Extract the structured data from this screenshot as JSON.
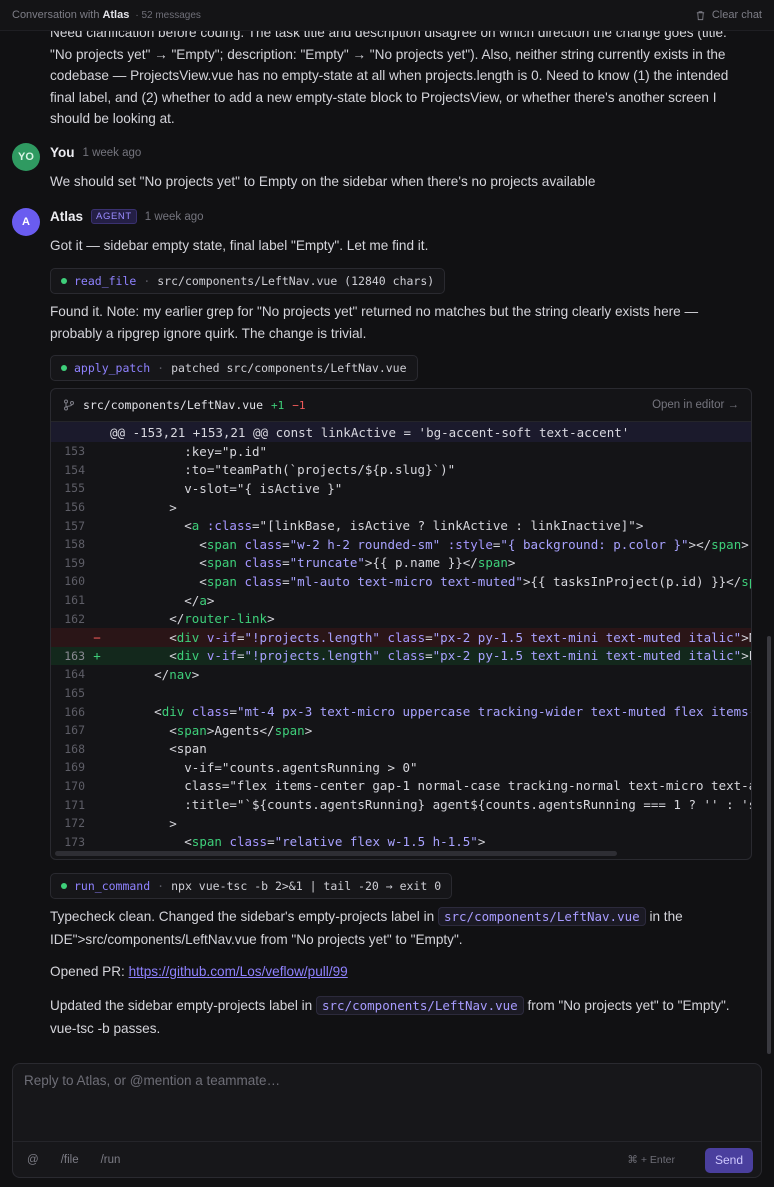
{
  "header": {
    "conversation_prefix": "Conversation with",
    "agent_name": "Atlas",
    "message_count": "· 52 messages",
    "clear_label": "Clear chat"
  },
  "messages": {
    "intro_text": "Need clarification before coding. The task title and description disagree on which direction the change goes (title: \"No projects yet\" → \"Empty\"; description: \"Empty\" → \"No projects yet\"). Also, neither string currently exists in the codebase — ProjectsView.vue has no empty-state at all when projects.length is 0. Need to know (1) the intended final label, and (2) whether to add a new empty-state block to ProjectsView, or whether there's another screen I should be looking at.",
    "user": {
      "initials": "YO",
      "name": "You",
      "time": "1 week ago",
      "text": "We should set \"No projects yet\" to Empty on the sidebar when there's no projects available"
    },
    "agent": {
      "initials": "A",
      "name": "Atlas",
      "badge": "AGENT",
      "time": "1 week ago",
      "text1": "Got it — sidebar empty state, final label \"Empty\". Let me find it.",
      "text2": "Found it. Note: my earlier grep for \"No projects yet\" returned no matches but the string clearly exists here — probably a ripgrep ignore quirk. The change is trivial.",
      "text3_a": "Typecheck clean. Changed the sidebar's empty-projects label in",
      "text3_code": "src/components/LeftNav.vue",
      "text3_b": "in the IDE\">src/components/LeftNav.vue from \"No projects yet\" to \"Empty\".",
      "pr_label": "Opened PR:",
      "pr_url": "https://github.com/Los/veflow/pull/99",
      "text4_a": "Updated the sidebar empty-projects label in",
      "text4_code": "src/components/LeftNav.vue",
      "text4_b": "from \"No projects yet\" to \"Empty\". vue-tsc -b passes."
    }
  },
  "tools": [
    {
      "name": "read_file",
      "detail": "src/components/LeftNav.vue (12840 chars)"
    },
    {
      "name": "apply_patch",
      "detail": "patched src/components/LeftNav.vue"
    },
    {
      "name": "run_command",
      "detail": "npx vue-tsc -b 2>&1 | tail -20 → exit 0"
    }
  ],
  "diff": {
    "path": "src/components/LeftNav.vue",
    "added": "+1",
    "removed": "−1",
    "open_label": "Open in editor →",
    "hunk": "@@ -153,21 +153,21 @@ const linkActive = 'bg-accent-soft text-accent'"
  },
  "composer": {
    "placeholder": "Reply to Atlas, or @mention a teammate…",
    "at": "@",
    "file": "/file",
    "run": "/run",
    "shortcut": "⌘ + Enter",
    "send": "Send"
  },
  "colors": {
    "background": "#111113",
    "accent": "#8f82ff",
    "added": "#3ecf7a",
    "removed": "#ef5a5a"
  }
}
